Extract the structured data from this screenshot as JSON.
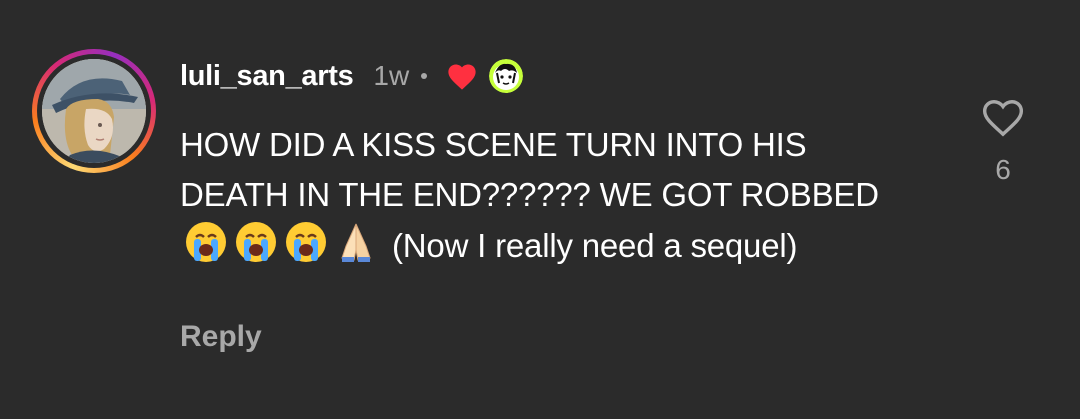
{
  "comment": {
    "username": "luli_san_arts",
    "timestamp": "1w",
    "text_line_1": "HOW DID A KISS SCENE TURN INTO HIS DEATH IN THE END?????? WE GOT ROBBED",
    "text_after_emoji": "(Now I really need a sequel)",
    "emojis": [
      "crying-face",
      "crying-face",
      "crying-face",
      "folded-hands"
    ],
    "reply_label": "Reply",
    "like_count": "6",
    "liked_by_creator": true
  },
  "colors": {
    "background": "#2b2b2b",
    "secondary_text": "#a8a8a8",
    "heart_red": "#ff3040"
  },
  "icons": {
    "liked_by_creator": "heart-filled-icon",
    "like": "heart-outline-icon"
  }
}
